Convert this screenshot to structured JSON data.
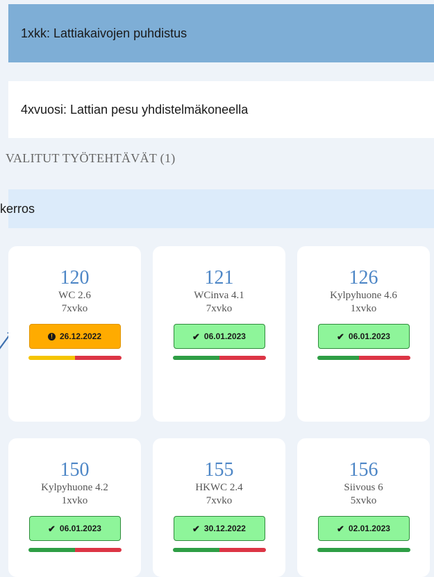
{
  "tasks": [
    {
      "label": "1xkk: Lattiakaivojen puhdistus"
    },
    {
      "label": "4xvuosi: Lattian pesu yhdistelmäkoneella"
    }
  ],
  "selected_tasks_heading": "VALITUT TYÖTEHTÄVÄT (1)",
  "floor_heading": "kerros",
  "colors": {
    "status_ok": "#8ef59a",
    "status_warn": "#ffab00",
    "bar_green": "#2e9e45",
    "bar_yellow": "#f5c400",
    "bar_red": "#dc3545",
    "room_number": "#4d86c6"
  },
  "rooms": [
    {
      "number": "120",
      "name": "WC 2.6",
      "frequency": "7xvko",
      "status": "warn",
      "status_icon": "exclamation-circle-icon",
      "date": "26.12.2022",
      "progress": 0.5,
      "progress_color": "yellow"
    },
    {
      "number": "121",
      "name": "WCinva 4.1",
      "frequency": "7xvko",
      "status": "ok",
      "status_icon": "check-icon",
      "date": "06.01.2023",
      "progress": 0.5,
      "progress_color": "green"
    },
    {
      "number": "126",
      "name": "Kylpyhuone 4.6",
      "frequency": "1xvko",
      "status": "ok",
      "status_icon": "check-icon",
      "date": "06.01.2023",
      "progress": 0.45,
      "progress_color": "green"
    },
    {
      "number": "150",
      "name": "Kylpyhuone 4.2",
      "frequency": "1xvko",
      "status": "ok",
      "status_icon": "check-icon",
      "date": "06.01.2023",
      "progress": 0.5,
      "progress_color": "green"
    },
    {
      "number": "155",
      "name": "HKWC 2.4",
      "frequency": "7xvko",
      "status": "ok",
      "status_icon": "check-icon",
      "date": "30.12.2022",
      "progress": 0.5,
      "progress_color": "green"
    },
    {
      "number": "156",
      "name": "Siivous 6",
      "frequency": "5xvko",
      "status": "ok",
      "status_icon": "check-icon",
      "date": "02.01.2023",
      "progress": 1.0,
      "progress_color": "green"
    }
  ]
}
